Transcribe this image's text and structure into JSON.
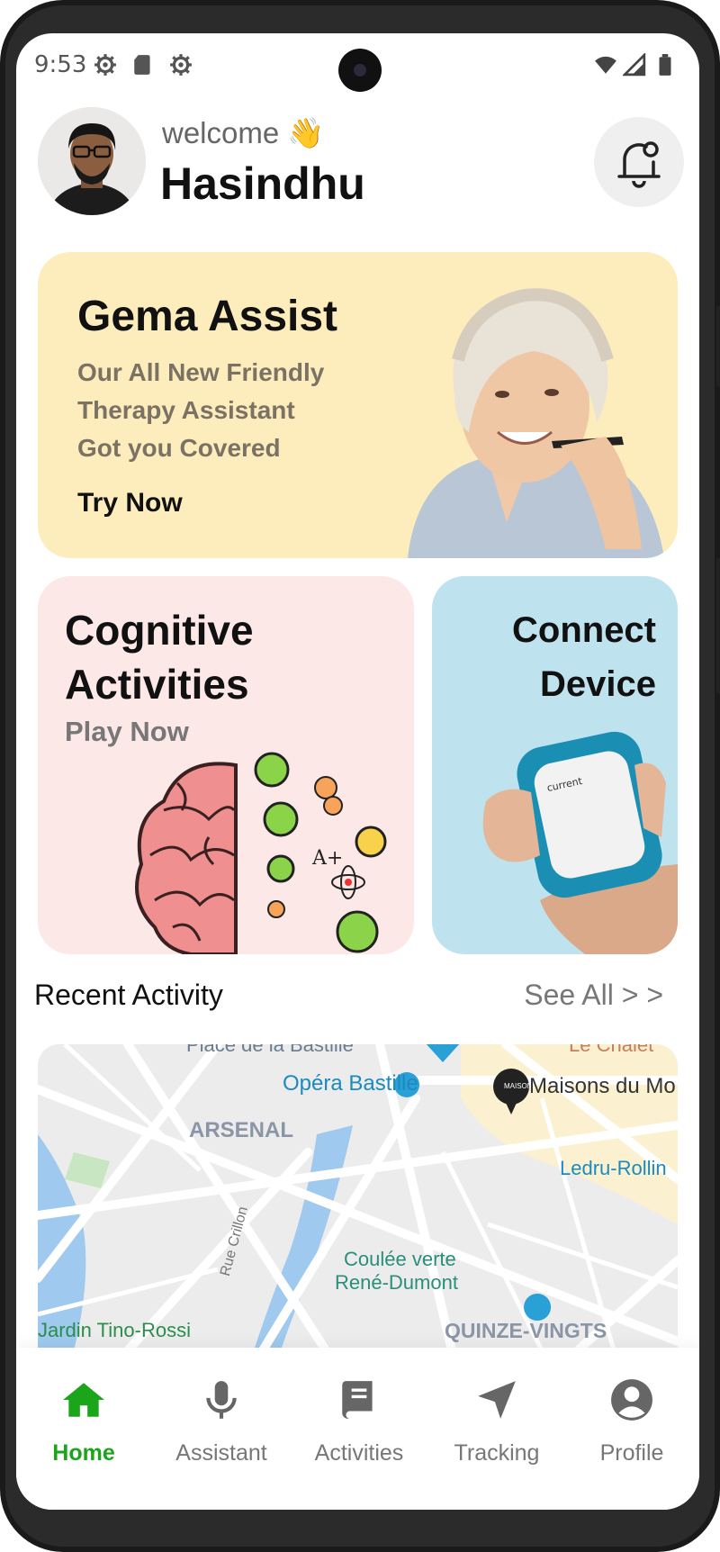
{
  "status_bar": {
    "time": "9:53",
    "icons": [
      "settings-icon",
      "sd-card-icon",
      "settings-icon",
      "wifi-icon",
      "signal-icon",
      "battery-icon"
    ]
  },
  "header": {
    "welcome": "welcome 👋",
    "username": "Hasindhu"
  },
  "gema_card": {
    "title": "Gema Assist",
    "lines": [
      "Our All New Friendly",
      "Therapy Assistant",
      "Got you Covered"
    ],
    "cta": "Try Now",
    "bg_color": "#fdedbd"
  },
  "cognitive_card": {
    "title_line1": "Cognitive",
    "title_line2": "Activities",
    "cta": "Play Now",
    "bg_color": "#fde8e8"
  },
  "connect_card": {
    "title_line1": "Connect",
    "title_line2": "Device",
    "device_text": "current",
    "bg_color": "#bfe3ee"
  },
  "recent": {
    "title": "Recent Activity",
    "see_all": "See All > >"
  },
  "map": {
    "labels": {
      "place_bastille": "Place de la Bastille",
      "le_chalet": "Le Chalet",
      "opera": "Opéra Bastille",
      "maisons": "Maisons du Mo",
      "maisons_badge": "MAISONS",
      "arsenal": "ARSENAL",
      "ledru": "Ledru-Rollin",
      "coulee1": "Coulée verte",
      "coulee2": "René-Dumont",
      "crillon": "Rue Crillon",
      "jardin": "Jardin Tino-Rossi",
      "quinze": "QUINZE-VINGTS"
    }
  },
  "nav": {
    "accent_color": "#1aa51a",
    "items": [
      {
        "label": "Home",
        "icon": "home-icon",
        "active": true
      },
      {
        "label": "Assistant",
        "icon": "microphone-icon",
        "active": false
      },
      {
        "label": "Activities",
        "icon": "book-icon",
        "active": false
      },
      {
        "label": "Tracking",
        "icon": "navigation-arrow-icon",
        "active": false
      },
      {
        "label": "Profile",
        "icon": "user-circle-icon",
        "active": false
      }
    ]
  }
}
